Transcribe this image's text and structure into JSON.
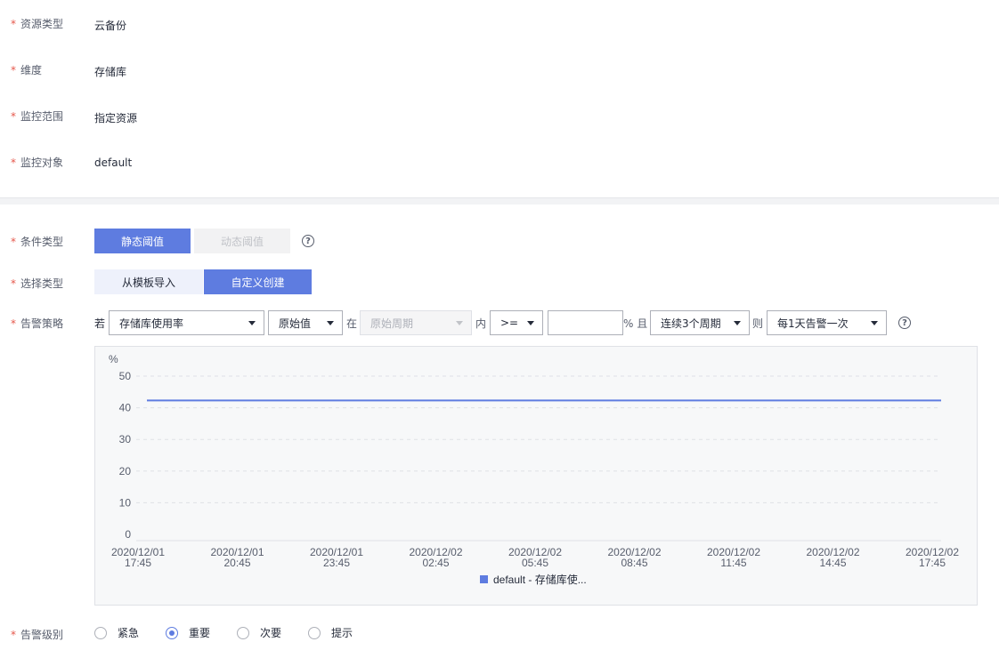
{
  "basic": {
    "resource_type": {
      "label": "资源类型",
      "value": "云备份"
    },
    "dimension": {
      "label": "维度",
      "value": "存储库"
    },
    "monitor_scope": {
      "label": "监控范围",
      "value": "指定资源"
    },
    "monitor_object": {
      "label": "监控对象",
      "value": "default"
    }
  },
  "condition_type": {
    "label": "条件类型",
    "static": "静态阈值",
    "dynamic": "动态阈值"
  },
  "select_type": {
    "label": "选择类型",
    "template": "从模板导入",
    "custom": "自定义创建"
  },
  "policy": {
    "label": "告警策略",
    "if_text": "若",
    "metric": "存储库使用率",
    "value_type": "原始值",
    "in_text": "在",
    "period": "原始周期",
    "within_text": "内",
    "operator": ">=",
    "threshold": "",
    "unit_and": "% 且",
    "consecutive": "连续3个周期",
    "then_text": "则",
    "frequency": "每1天告警一次"
  },
  "chart_data": {
    "type": "line",
    "ylabel": "%",
    "ylim": [
      0,
      50
    ],
    "yticks": [
      "50",
      "40",
      "30",
      "20",
      "10",
      "0"
    ],
    "x": [
      [
        "2020/12/01",
        "17:45"
      ],
      [
        "2020/12/01",
        "20:45"
      ],
      [
        "2020/12/01",
        "23:45"
      ],
      [
        "2020/12/02",
        "02:45"
      ],
      [
        "2020/12/02",
        "05:45"
      ],
      [
        "2020/12/02",
        "08:45"
      ],
      [
        "2020/12/02",
        "11:45"
      ],
      [
        "2020/12/02",
        "14:45"
      ],
      [
        "2020/12/02",
        "17:45"
      ]
    ],
    "series": [
      {
        "name": "default - 存储库使...",
        "values": [
          42.3,
          42.3,
          42.3,
          42.3,
          42.3,
          42.3,
          42.3,
          42.3,
          42.3
        ],
        "color": "#5e7ce0"
      }
    ],
    "grid": true,
    "legend": "bottom-center"
  },
  "alarm_level": {
    "label": "告警级别",
    "options": [
      "紧急",
      "重要",
      "次要",
      "提示"
    ],
    "selected": "重要"
  },
  "colors": {
    "primary": "#5e7ce0",
    "required": "#e5574b"
  },
  "icons": {
    "help": "help-circle-icon",
    "dropdown": "caret-down-icon"
  }
}
